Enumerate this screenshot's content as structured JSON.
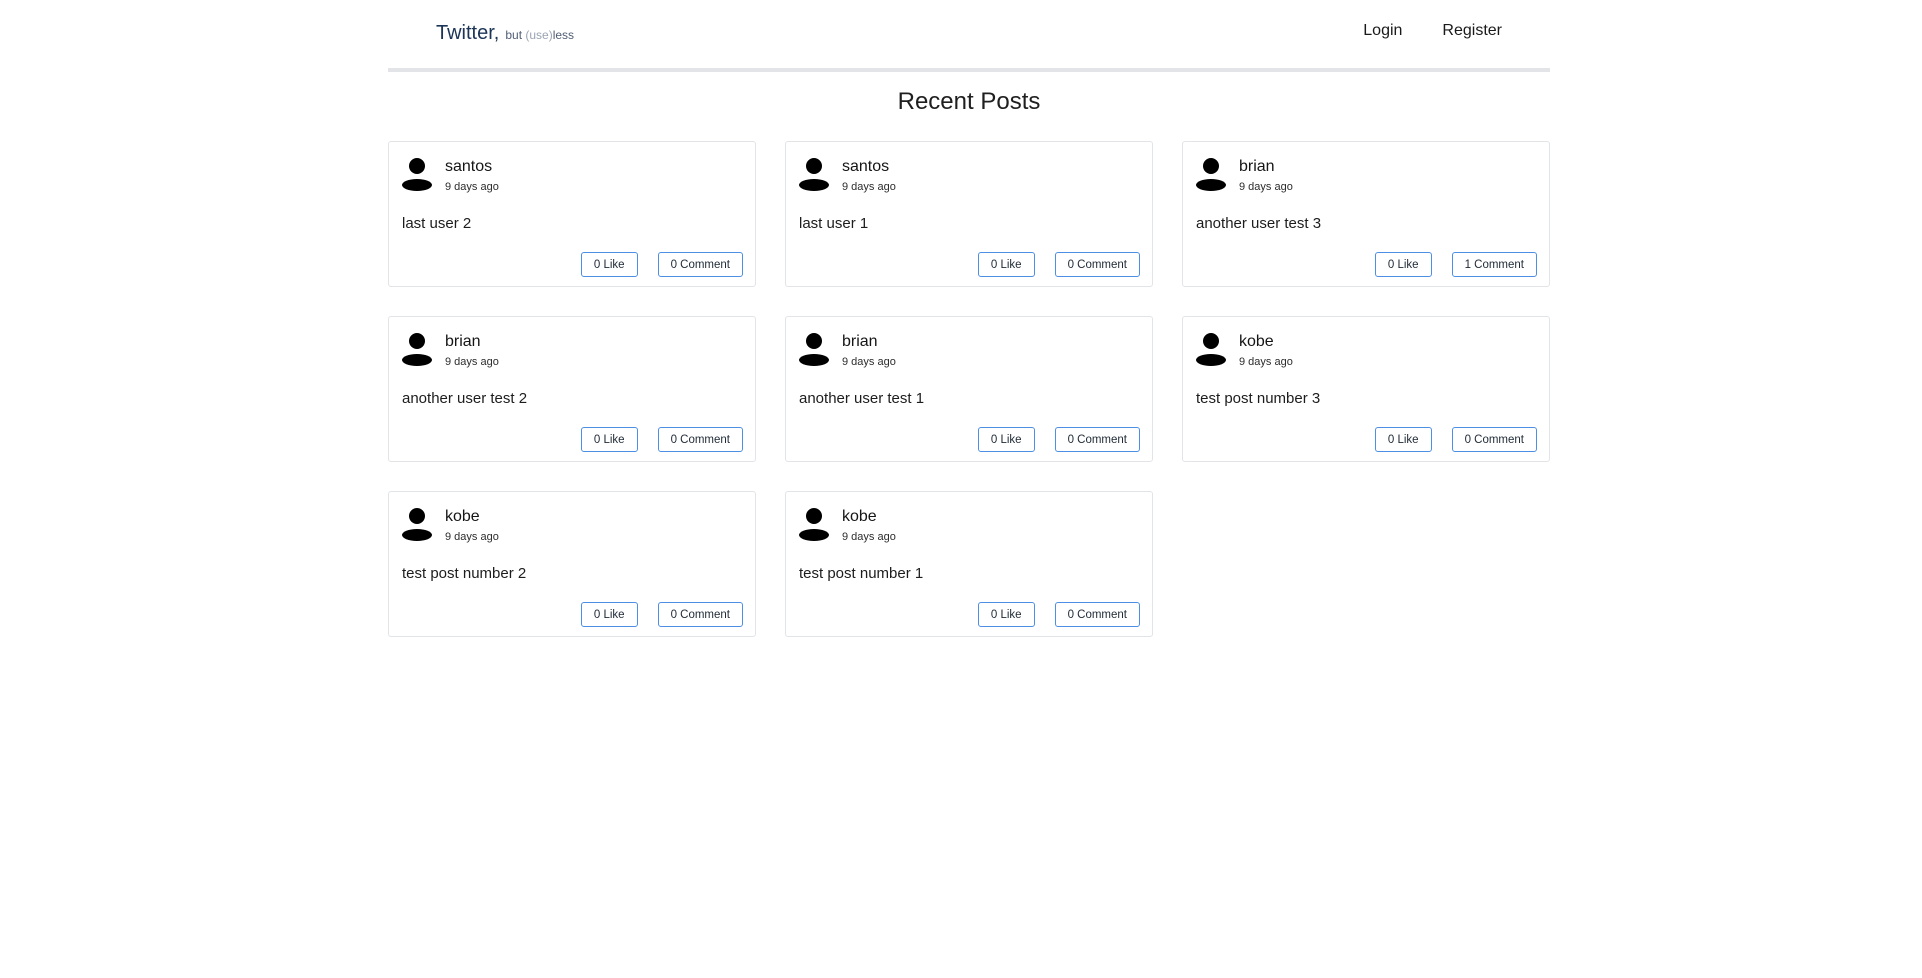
{
  "header": {
    "brand_main": "Twitter,",
    "brand_sub_prefix": "but ",
    "brand_sub_light": "(use)",
    "brand_sub_suffix": "less",
    "nav": {
      "login": "Login",
      "register": "Register"
    }
  },
  "main": {
    "title": "Recent Posts",
    "posts": [
      {
        "author": "santos",
        "time": "9 days ago",
        "text": "last user 2",
        "like_label": "0 Like",
        "comment_label": "0 Comment"
      },
      {
        "author": "santos",
        "time": "9 days ago",
        "text": "last user 1",
        "like_label": "0 Like",
        "comment_label": "0 Comment"
      },
      {
        "author": "brian",
        "time": "9 days ago",
        "text": "another user test 3",
        "like_label": "0 Like",
        "comment_label": "1 Comment"
      },
      {
        "author": "brian",
        "time": "9 days ago",
        "text": "another user test 2",
        "like_label": "0 Like",
        "comment_label": "0 Comment"
      },
      {
        "author": "brian",
        "time": "9 days ago",
        "text": "another user test 1",
        "like_label": "0 Like",
        "comment_label": "0 Comment"
      },
      {
        "author": "kobe",
        "time": "9 days ago",
        "text": "test post number 3",
        "like_label": "0 Like",
        "comment_label": "0 Comment"
      },
      {
        "author": "kobe",
        "time": "9 days ago",
        "text": "test post number 2",
        "like_label": "0 Like",
        "comment_label": "0 Comment"
      },
      {
        "author": "kobe",
        "time": "9 days ago",
        "text": "test post number 1",
        "like_label": "0 Like",
        "comment_label": "0 Comment"
      }
    ]
  },
  "icons": {
    "avatar": "user-avatar-icon"
  },
  "colors": {
    "brand": "#1c3557",
    "button_border": "#4c8fe4",
    "card_border": "#e2e4e8",
    "header_rule": "#e3e4e8"
  }
}
